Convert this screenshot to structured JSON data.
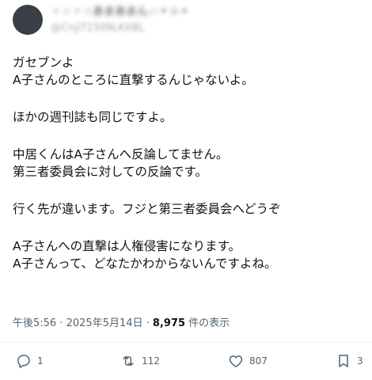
{
  "author": {
    "name": "・☆・☆あまあまん☆・☆・",
    "handle": "@CnjiT15II9LKXBL"
  },
  "tweet": {
    "lines": [
      "ガセブンよ",
      "A子さんのところに直撃するんじゃないよ。",
      "",
      "ほかの週刊誌も同じですよ。",
      "",
      "中居くんはA子さんへ反論してません。",
      "第三者委員会に対しての反論です。",
      "",
      "行く先が違います。フジと第三者委員会へどうぞ",
      "",
      "A子さんへの直撃は人権侵害になります。",
      "A子さんって、どなたかわからないんですよね。"
    ]
  },
  "meta": {
    "time": "午後5:56",
    "sep1": " · ",
    "date": "2025年5月14日",
    "sep2": " · ",
    "views_count": "8,975",
    "views_label": " 件の表示"
  },
  "actions": {
    "reply_count": "1",
    "retweet_count": "112",
    "like_count": "807",
    "bookmark_count": "3"
  },
  "icons": {
    "reply": "reply-icon",
    "retweet": "retweet-icon",
    "like": "heart-icon",
    "bookmark": "bookmark-icon"
  },
  "colors": {
    "text": "#0f1419",
    "secondary": "#536471",
    "divider": "#eff3f4"
  }
}
